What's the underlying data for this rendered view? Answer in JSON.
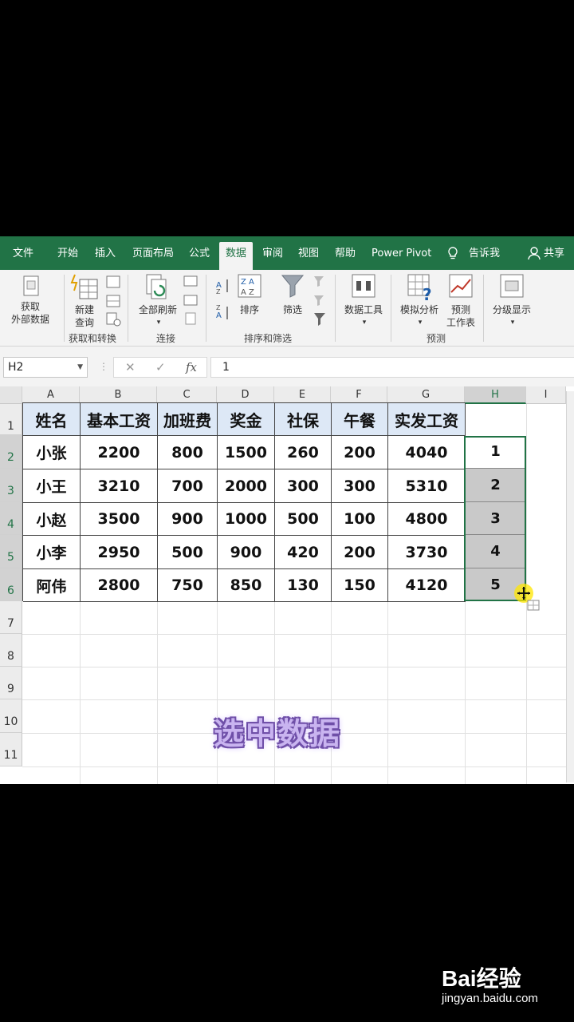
{
  "tabs": [
    "文件",
    "开始",
    "插入",
    "页面布局",
    "公式",
    "数据",
    "审阅",
    "视图",
    "帮助",
    "Power Pivot",
    "告诉我",
    "共享"
  ],
  "ribbon": {
    "get_external": "获取",
    "get_external_2": "外部数据",
    "new_query": "新建",
    "new_query_2": "查询",
    "group_get": "获取和转换",
    "refresh_all": "全部刷新",
    "group_conn": "连接",
    "sort": "排序",
    "filter": "筛选",
    "group_sort": "排序和筛选",
    "data_tools": "数据工具",
    "what_if": "模拟分析",
    "forecast": "预测",
    "forecast_sheet": "工作表",
    "group_forecast": "预测",
    "outline": "分级显示"
  },
  "formula_bar": {
    "name_box": "H2",
    "cancel": "✕",
    "enter": "✓",
    "fx": "fx",
    "value": "1"
  },
  "columns": [
    "A",
    "B",
    "C",
    "D",
    "E",
    "F",
    "G",
    "H",
    "I"
  ],
  "rows": [
    "1",
    "2",
    "3",
    "4",
    "5",
    "6",
    "7",
    "8",
    "9",
    "10",
    "11"
  ],
  "table": {
    "headers": [
      "姓名",
      "基本工资",
      "加班费",
      "奖金",
      "社保",
      "午餐",
      "实发工资"
    ],
    "rows": [
      [
        "小张",
        "2200",
        "800",
        "1500",
        "260",
        "200",
        "4040"
      ],
      [
        "小王",
        "3210",
        "700",
        "2000",
        "300",
        "300",
        "5310"
      ],
      [
        "小赵",
        "3500",
        "900",
        "1000",
        "500",
        "100",
        "4800"
      ],
      [
        "小李",
        "2950",
        "500",
        "900",
        "420",
        "200",
        "3730"
      ],
      [
        "阿伟",
        "2800",
        "750",
        "850",
        "130",
        "150",
        "4120"
      ]
    ],
    "h_values": [
      "1",
      "2",
      "3",
      "4",
      "5"
    ]
  },
  "caption": "选中数据",
  "watermark": {
    "main": "Bai经验",
    "sub": "jingyan.baidu.com"
  },
  "colors": {
    "excel_green": "#217346",
    "header_fill": "#dde8f6",
    "selection_fill": "#c9c9c9"
  }
}
